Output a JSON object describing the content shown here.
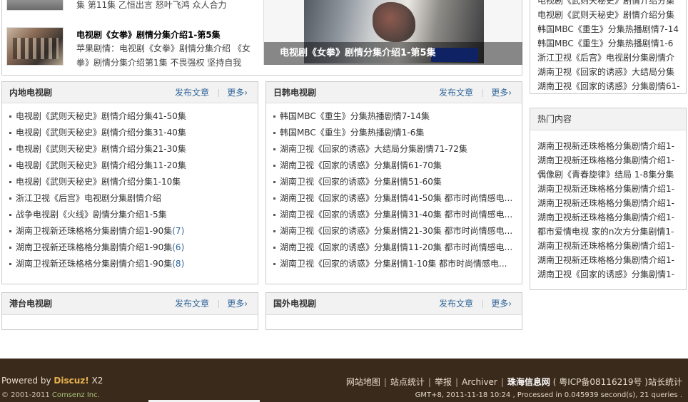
{
  "top": {
    "item1": {
      "desc": "集 第11集 乙恒出言 怒叶飞鸿 众人合力"
    },
    "item2": {
      "title": "电视剧《女拳》剧情分集介绍1-第5集",
      "desc": "苹果剧情：电视剧《女拳》剧情分集介绍 《女拳》剧情分集介绍第1集 不畏强权 坚持自我"
    },
    "slide_caption": "电视剧《女拳》剧情分集介绍1-第5集"
  },
  "labels": {
    "post": "发布文章",
    "more": "更多›"
  },
  "mainland": {
    "title": "内地电视剧",
    "items": [
      {
        "text": "电视剧《武则天秘史》剧情介绍分集41-50集",
        "count": ""
      },
      {
        "text": "电视剧《武则天秘史》剧情介绍分集31-40集",
        "count": ""
      },
      {
        "text": "电视剧《武则天秘史》剧情介绍分集21-30集",
        "count": ""
      },
      {
        "text": "电视剧《武则天秘史》剧情介绍分集11-20集",
        "count": ""
      },
      {
        "text": "电视剧《武则天秘史》剧情介绍分集1-10集",
        "count": ""
      },
      {
        "text": "浙江卫视《后宫》电视剧分集剧情介绍",
        "count": ""
      },
      {
        "text": "战争电视剧《火线》剧情分集介绍1-5集",
        "count": ""
      },
      {
        "text": "湖南卫视新还珠格格分集剧情介绍1-90集",
        "count": "(7)"
      },
      {
        "text": "湖南卫视新还珠格格分集剧情介绍1-90集",
        "count": "(6)"
      },
      {
        "text": "湖南卫视新还珠格格分集剧情介绍1-90集",
        "count": "(8)"
      }
    ]
  },
  "jpkr": {
    "title": "日韩电视剧",
    "items": [
      "韩国MBC《重生》分集热播剧情7-14集",
      "韩国MBC《重生》分集热播剧情1-6集",
      "湖南卫视《回家的诱惑》大结局分集剧情71-72集",
      "湖南卫视《回家的诱惑》分集剧情61-70集",
      "湖南卫视《回家的诱惑》分集剧情51-60集",
      "湖南卫视《回家的诱惑》分集剧情41-50集 都市时尚情感电...",
      "湖南卫视《回家的诱惑》分集剧情31-40集 都市时尚情感电...",
      "湖南卫视《回家的诱惑》分集剧情21-30集 都市时尚情感电...",
      "湖南卫视《回家的诱惑》分集剧情11-20集 都市时尚情感电...",
      "湖南卫视《回家的诱惑》分集剧情1-10集 都市时尚情感电..."
    ]
  },
  "hktw": {
    "title": "港台电视剧"
  },
  "foreign": {
    "title": "国外电视剧"
  },
  "side_top": {
    "items": [
      "电视剧《武则天秘史》剧情介绍分集",
      "电视剧《武则天秘史》剧情介绍分集",
      "韩国MBC《重生》分集热播剧情7-14",
      "韩国MBC《重生》分集热播剧情1-6",
      "浙江卫视《后宫》电视剧分集剧情介",
      "湖南卫视《回家的诱惑》大结局分集",
      "湖南卫视《回家的诱惑》分集剧情61-"
    ]
  },
  "side_hot": {
    "title": "热门内容",
    "items": [
      "湖南卫视新还珠格格分集剧情介绍1-",
      "湖南卫视新还珠格格分集剧情介绍1-",
      "偶像剧《青春旋律》结局 1-8集分集",
      "湖南卫视新还珠格格分集剧情介绍1-",
      "湖南卫视新还珠格格分集剧情介绍1-",
      "湖南卫视新还珠格格分集剧情介绍1-",
      "都市爱情电视 家的n次方分集剧情1-",
      "湖南卫视新还珠格格分集剧情介绍1-",
      "湖南卫视新还珠格格分集剧情介绍1-",
      "湖南卫视《回家的诱惑》分集剧情1-"
    ]
  },
  "footer": {
    "powered_prefix": "Powered by ",
    "powered_brand": "Discuz!",
    "powered_ver": " X2",
    "copyright_prefix": "© 2001-2011 ",
    "copyright_company": "Comsenz Inc.",
    "links": [
      "网站地图",
      "站点统计",
      "举报",
      "Archiver"
    ],
    "site_name": "珠海信息网",
    "icp": "( 粤ICP备08116219号 )",
    "admin_link": "站长统计",
    "info": "GMT+8, 2011-11-18 10:24 , Processed in 0.045939 second(s), 21 queries ."
  }
}
